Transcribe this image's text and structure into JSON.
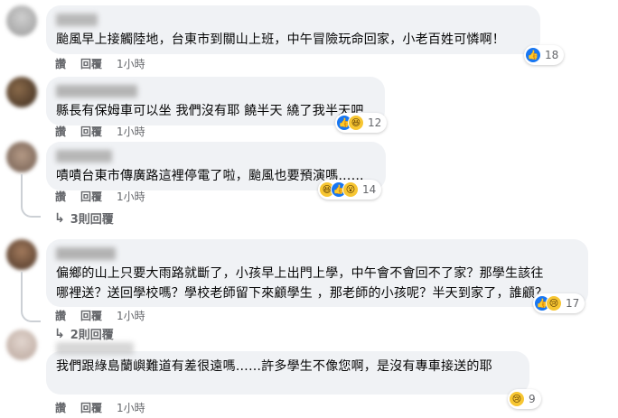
{
  "comments": [
    {
      "text": "颱風早上接觸陸地，台東市到關山上班，中午冒險玩命回家，小老百姓可憐啊！",
      "reactions": [
        "like-icon"
      ],
      "reaction_count": "18",
      "like_label": "讚",
      "reply_label": "回覆",
      "time": "1小時"
    },
    {
      "text": "縣長有保姆車可以坐 我們沒有耶 饒半天 繞了我半天吧",
      "reactions": [
        "like-icon",
        "haha-icon"
      ],
      "reaction_count": "12",
      "like_label": "讚",
      "reply_label": "回覆",
      "time": "1小時"
    },
    {
      "text": "嘖嘖台東市傳廣路這裡停電了啦，颱風也要預演嗎……",
      "reactions": [
        "haha-icon",
        "like-icon",
        "wow-icon"
      ],
      "reaction_count": "14",
      "like_label": "讚",
      "reply_label": "回覆",
      "time": "1小時",
      "replies_label": "3則回覆"
    },
    {
      "text": "偏鄉的山上只要大雨路就斷了，小孩早上出門上學，中午會不會回不了家？那學生該往\n哪裡送？送回學校嗎？學校老師留下來顧學生 ，那老師的小孩呢？半天到家了，誰顧？",
      "reactions": [
        "like-icon",
        "sad-icon"
      ],
      "reaction_count": "17",
      "like_label": "讚",
      "reply_label": "回覆",
      "time": "1小時",
      "replies_label": "2則回覆"
    },
    {
      "text": "我們跟綠島蘭嶼難道有差很遠嗎……許多學生不像您啊，是沒有專車接送的耶",
      "reactions": [
        "sad-icon"
      ],
      "reaction_count": "9",
      "like_label": "讚",
      "reply_label": "回覆",
      "time": "1小時"
    }
  ],
  "colors": {
    "bubble": "#f0f2f5",
    "meta_text": "#65676b",
    "like_blue": "#1877f2",
    "emoji_yellow": "#f7c632",
    "thread_line": "#ccd0d5"
  }
}
